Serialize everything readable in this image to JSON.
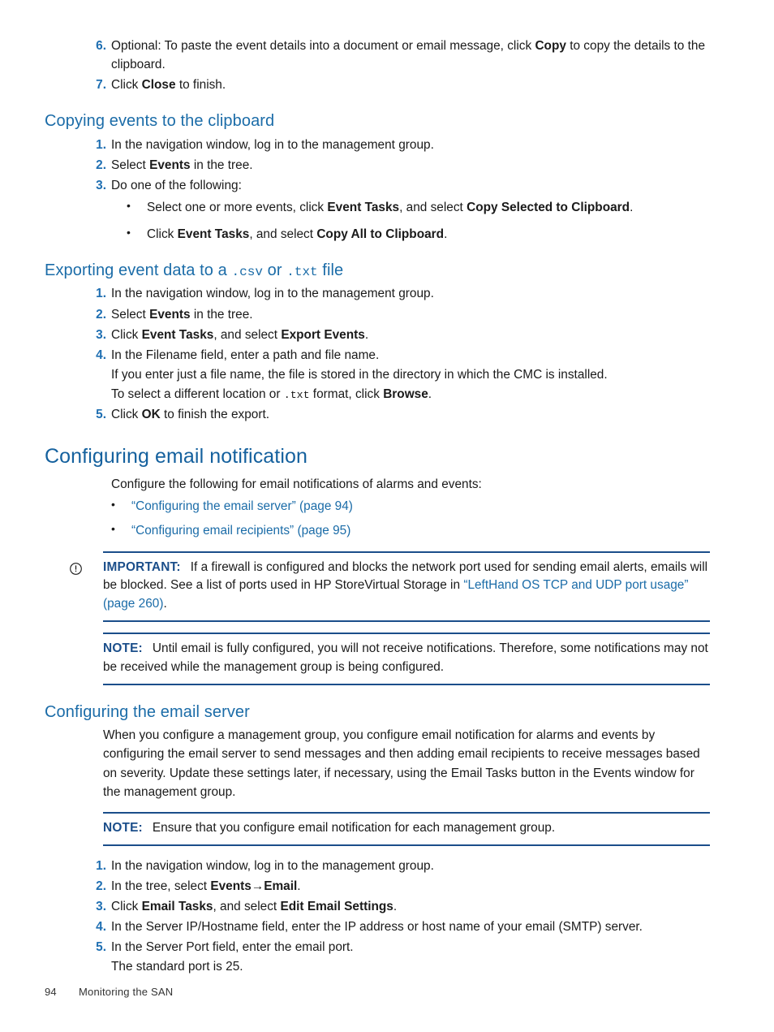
{
  "document": {
    "footer": {
      "page_number": "94",
      "running_title": "Monitoring the SAN"
    },
    "colors": {
      "heading_blue": "#1B6CA8",
      "h1_blue": "#15619E",
      "number_blue": "#1F6FB2",
      "rule_navy": "#1B4E8A",
      "link_blue": "#1B6CA8",
      "body_black": "#1a1a1a"
    }
  },
  "top_steps": [
    {
      "num": "6.",
      "prefix": "Optional: To paste the event details into a document or email message, click ",
      "bold": "Copy",
      "suffix": " to copy the details to the clipboard."
    },
    {
      "num": "7.",
      "prefix": "Click ",
      "bold": "Close",
      "suffix": " to finish."
    }
  ],
  "section_copying": {
    "heading": "Copying events to the clipboard",
    "steps": [
      {
        "num": "1.",
        "text": "In the navigation window, log in to the management group."
      },
      {
        "num": "2.",
        "prefix": "Select ",
        "bold": "Events",
        "suffix": " in the tree."
      },
      {
        "num": "3.",
        "text": "Do one of the following:"
      }
    ],
    "bullets": [
      {
        "p1": "Select one or more events, click ",
        "b1": "Event Tasks",
        "p2": ", and select ",
        "b2": "Copy Selected to Clipboard",
        "p3": "."
      },
      {
        "p1": "Click ",
        "b1": "Event Tasks",
        "p2": ", and select ",
        "b2": "Copy All to Clipboard",
        "p3": "."
      }
    ]
  },
  "section_exporting": {
    "heading_part1": "Exporting event data to a ",
    "heading_mono1": ".csv",
    "heading_part2": " or ",
    "heading_mono2": ".txt",
    "heading_part3": " file",
    "steps": [
      {
        "num": "1.",
        "text": "In the navigation window, log in to the management group."
      },
      {
        "num": "2.",
        "prefix": "Select ",
        "bold": "Events",
        "suffix": " in the tree."
      },
      {
        "num": "3.",
        "prefix": "Click ",
        "bold": "Event Tasks",
        "suffix": ", and select ",
        "bold2": "Export Events",
        "suffix2": "."
      },
      {
        "num": "4.",
        "text": "In the Filename field, enter a path and file name."
      },
      {
        "num": "5.",
        "prefix": "Click ",
        "bold": "OK",
        "suffix": " to finish the export."
      }
    ],
    "step4_cont1": "If you enter just a file name, the file is stored in the directory in which the CMC is installed.",
    "step4_cont2_pre": "To select a different location or ",
    "step4_cont2_mono": ".txt",
    "step4_cont2_mid": " format, click ",
    "step4_cont2_bold": "Browse",
    "step4_cont2_post": "."
  },
  "section_email_notification": {
    "heading": "Configuring email notification",
    "intro": "Configure the following for email notifications of alarms and events:",
    "links": [
      {
        "title": "“Configuring the email server”",
        "page_ref": " (page 94)"
      },
      {
        "title": "“Configuring email recipients”",
        "page_ref": " (page 95)"
      }
    ],
    "important": {
      "icon": "important-circle-exclamation-icon",
      "label": "IMPORTANT:",
      "text_pre": "If a firewall is configured and blocks the network port used for sending email alerts, emails will be blocked. See a list of ports used in HP StoreVirtual Storage in ",
      "link": "“LeftHand OS TCP and UDP port usage” (page 260)",
      "text_post": "."
    },
    "note": {
      "label": "NOTE:",
      "text": "Until email is fully configured, you will not receive notifications. Therefore, some notifications may not be received while the management group is being configured."
    }
  },
  "section_email_server": {
    "heading": "Configuring the email server",
    "body": "When you configure a management group, you configure email notification for alarms and events by configuring the email server to send messages and then adding email recipients to receive messages based on severity. Update these settings later, if necessary, using the Email Tasks button in the Events window for the management group.",
    "note": {
      "label": "NOTE:",
      "text": "Ensure that you configure email notification for each management group."
    },
    "steps": [
      {
        "num": "1.",
        "text": "In the navigation window, log in to the management group."
      },
      {
        "num": "2.",
        "prefix": "In the tree, select ",
        "bold": "Events→Email",
        "suffix": "."
      },
      {
        "num": "3.",
        "prefix": "Click ",
        "bold": "Email Tasks",
        "suffix": ", and select ",
        "bold2": "Edit Email Settings",
        "suffix2": "."
      },
      {
        "num": "4.",
        "text": "In the Server IP/Hostname field, enter the IP address or host name of your email (SMTP) server."
      },
      {
        "num": "5.",
        "text": "In the Server Port field, enter the email port."
      }
    ],
    "step5_cont": "The standard port is 25."
  }
}
